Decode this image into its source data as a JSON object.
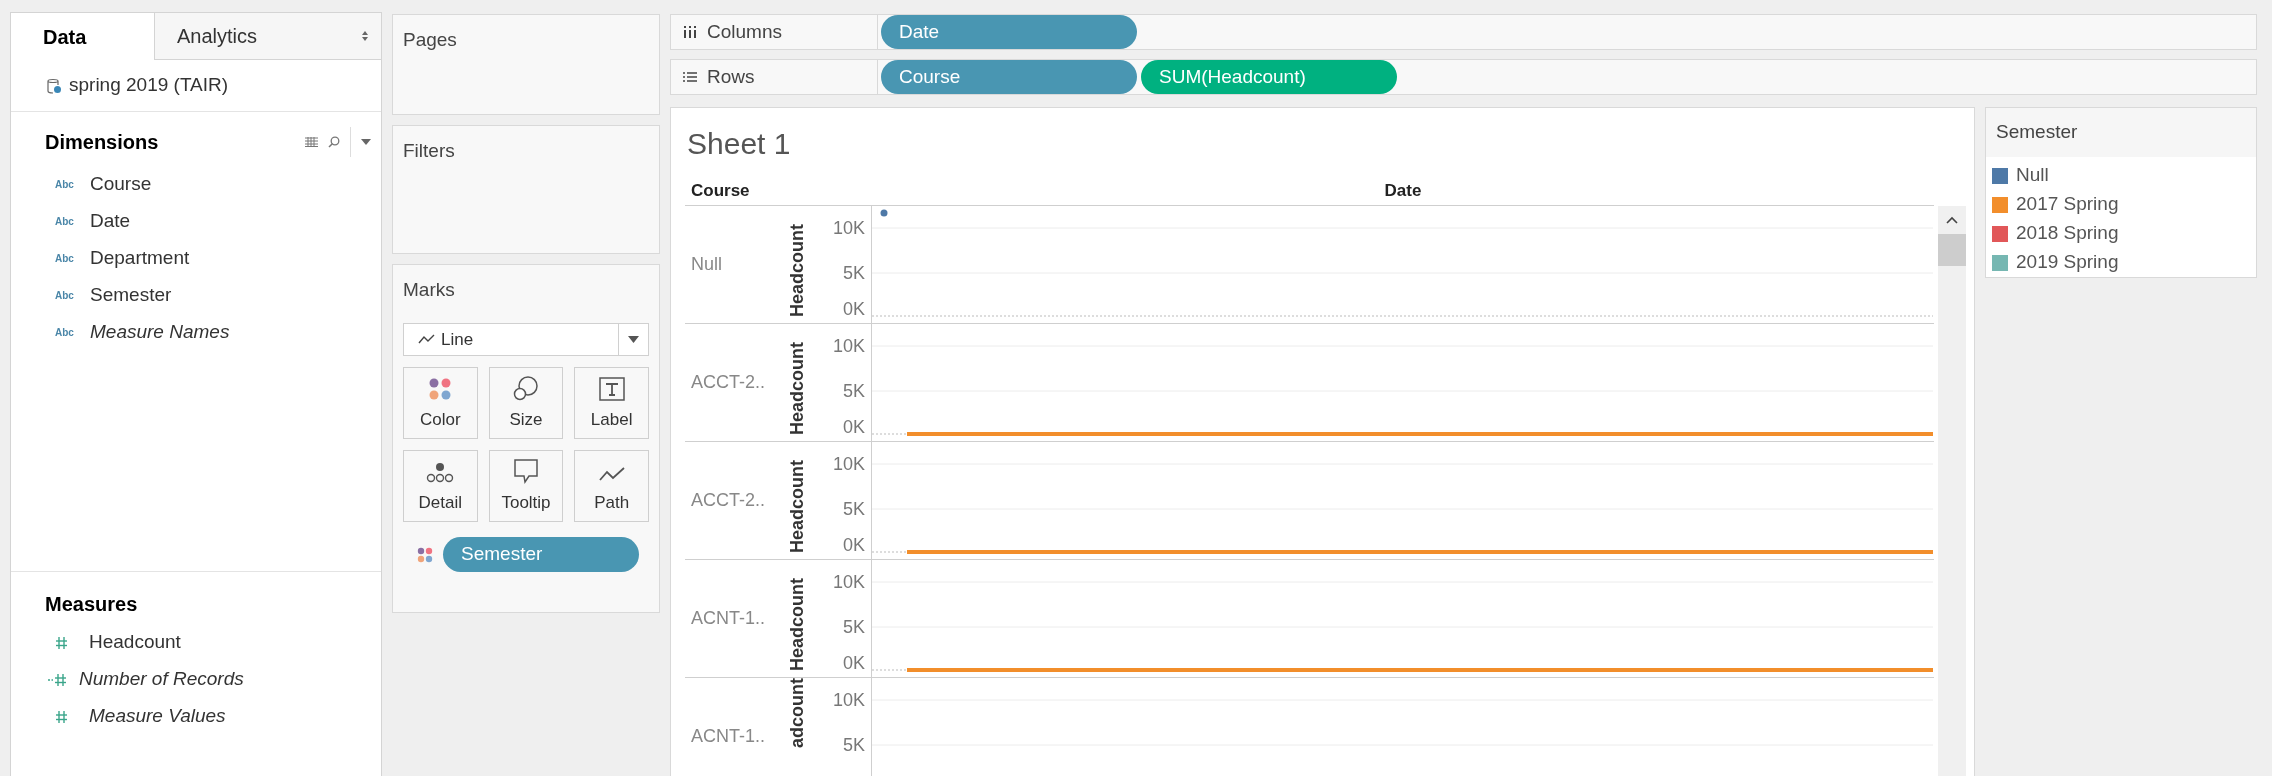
{
  "side_tabs": [
    {
      "label": "Data",
      "selected": true
    },
    {
      "label": "Analytics",
      "selected": false
    }
  ],
  "data_source": "spring 2019 (TAIR)",
  "dimensions": {
    "title": "Dimensions",
    "items": [
      {
        "type_label": "Abc",
        "name": "Course",
        "italic": false
      },
      {
        "type_label": "Abc",
        "name": "Date",
        "italic": false
      },
      {
        "type_label": "Abc",
        "name": "Department",
        "italic": false
      },
      {
        "type_label": "Abc",
        "name": "Semester",
        "italic": false
      },
      {
        "type_label": "Abc",
        "name": "Measure Names",
        "italic": true
      }
    ]
  },
  "measures": {
    "title": "Measures",
    "items": [
      {
        "kind": "field",
        "name": "Headcount",
        "italic": false
      },
      {
        "kind": "generated",
        "name": "Number of Records",
        "italic": true
      },
      {
        "kind": "field",
        "name": "Measure Values",
        "italic": true
      }
    ]
  },
  "pages": {
    "title": "Pages"
  },
  "filters": {
    "title": "Filters"
  },
  "marks": {
    "title": "Marks",
    "mark_type": "Line",
    "buttons": [
      {
        "kind": "color",
        "label": "Color"
      },
      {
        "kind": "size",
        "label": "Size"
      },
      {
        "kind": "label",
        "label": "Label"
      },
      {
        "kind": "detail",
        "label": "Detail"
      },
      {
        "kind": "tooltip",
        "label": "Tooltip"
      },
      {
        "kind": "path",
        "label": "Path"
      }
    ],
    "pills": [
      {
        "kind": "color",
        "label": "Semester"
      }
    ]
  },
  "shelves": [
    {
      "kind": "columns",
      "label": "Columns",
      "pills": [
        {
          "label": "Date",
          "color": "#4996b2"
        }
      ]
    },
    {
      "kind": "rows",
      "label": "Rows",
      "pills": [
        {
          "label": "Course",
          "color": "#4996b2"
        },
        {
          "label": "SUM(Headcount)",
          "color": "#00b180"
        }
      ]
    }
  ],
  "sheet": {
    "title": "Sheet 1",
    "row_header": "Course",
    "column_header": "Date",
    "panes": [
      {
        "label": "Null",
        "axis_title": "Headcount",
        "ticks": [
          "10K",
          "5K",
          "0K"
        ],
        "mark": {
          "kind": "dot",
          "color": "#4e79a7"
        }
      },
      {
        "label": "ACCT-2..",
        "axis_title": "Headcount",
        "ticks": [
          "10K",
          "5K",
          "0K"
        ],
        "mark": {
          "kind": "line",
          "color": "#f28e2b"
        }
      },
      {
        "label": "ACCT-2..",
        "axis_title": "Headcount",
        "ticks": [
          "10K",
          "5K",
          "0K"
        ],
        "mark": {
          "kind": "line",
          "color": "#f28e2b"
        }
      },
      {
        "label": "ACNT-1..",
        "axis_title": "Headcount",
        "ticks": [
          "10K",
          "5K",
          "0K"
        ],
        "mark": {
          "kind": "line",
          "color": "#f28e2b"
        }
      },
      {
        "label": "ACNT-1..",
        "axis_title": "adcount",
        "ticks": [
          "10K",
          "5K"
        ]
      }
    ]
  },
  "legend": {
    "title": "Semester",
    "items": [
      {
        "label": "Null",
        "color": "#4e79a7"
      },
      {
        "label": "2017 Spring",
        "color": "#f28e2b"
      },
      {
        "label": "2018 Spring",
        "color": "#e15759"
      },
      {
        "label": "2019 Spring",
        "color": "#76b7b2"
      }
    ]
  }
}
